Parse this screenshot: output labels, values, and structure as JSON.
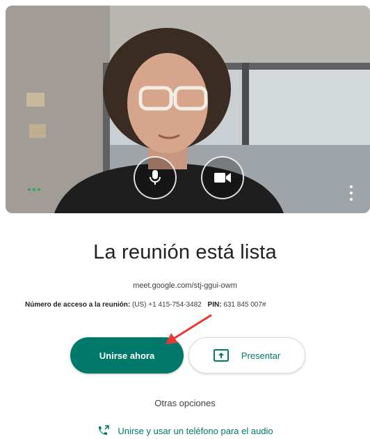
{
  "preview": {
    "mic_button_icon": "microphone-icon",
    "camera_button_icon": "video-camera-icon",
    "audio_indicator_icon": "audio-level-dots-icon",
    "more_icon": "more-vert-icon"
  },
  "title": "La reunión está lista",
  "meeting_url": "meet.google.com/stj-ggui-owm",
  "access": {
    "label": "Número de acceso a la reunión:",
    "number": "(US) +1 415-754-3482",
    "pin_label": "PIN:",
    "pin": "631 845 007#"
  },
  "buttons": {
    "join": "Unirse ahora",
    "present": "Presentar"
  },
  "other_options": "Otras opciones",
  "phone_audio": "Unirse y usar un teléfono para el audio",
  "colors": {
    "accent": "#00796b",
    "annotation_arrow": "#e53935",
    "audio_indicator": "#34a853"
  }
}
